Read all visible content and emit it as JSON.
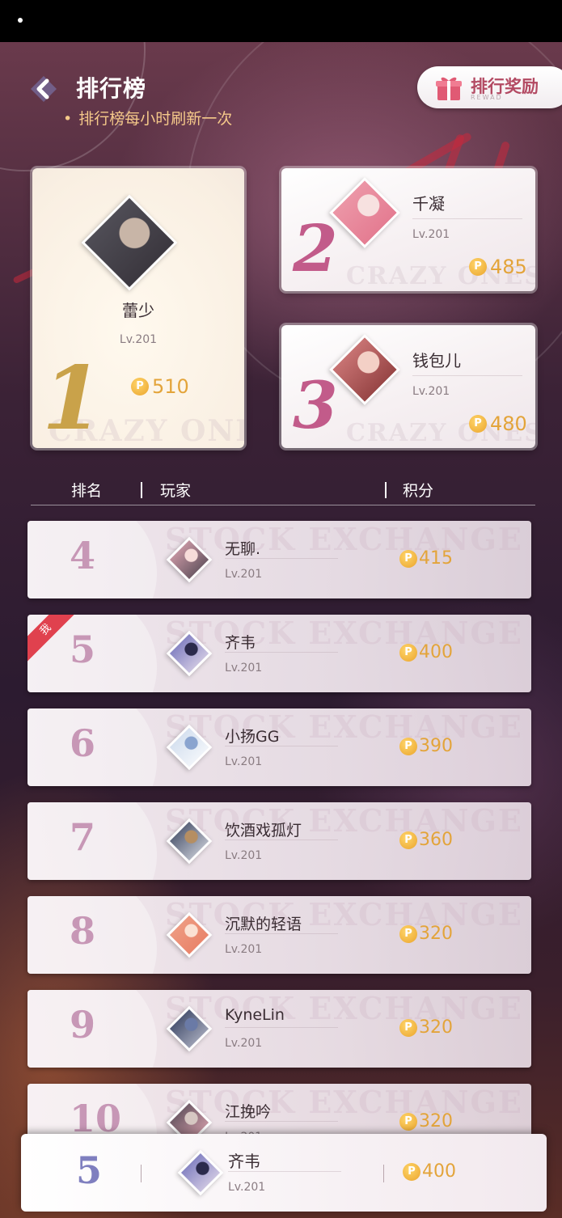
{
  "header": {
    "title": "排行榜",
    "subtitle": "排行榜每小时刷新一次",
    "reward_button": {
      "label": "排行奖励",
      "sub": "REWAD"
    }
  },
  "podium": [
    {
      "rank": "1",
      "name": "蕾少",
      "level": "Lv.201",
      "points": "510",
      "avatar_colors": [
        "#5b5a63",
        "#2f2a31",
        "#c8b5a7"
      ]
    },
    {
      "rank": "2",
      "name": "千凝",
      "level": "Lv.201",
      "points": "485",
      "avatar_colors": [
        "#f0a5b2",
        "#e06d86",
        "#f7e1e0"
      ]
    },
    {
      "rank": "3",
      "name": "钱包儿",
      "level": "Lv.201",
      "points": "480",
      "avatar_colors": [
        "#e58e8e",
        "#7a2a2a",
        "#f3d0c6"
      ]
    }
  ],
  "podium_ghost_text": "CRAZY ONES",
  "columns": {
    "rank": "排名",
    "player": "玩家",
    "score": "积分"
  },
  "rows": [
    {
      "rank": "4",
      "name": "无聊.",
      "level": "Lv.201",
      "points": "415",
      "me": false,
      "avatar_colors": [
        "#f3b3c0",
        "#3e3a45",
        "#f7dcd9"
      ]
    },
    {
      "rank": "5",
      "name": "齐韦",
      "level": "Lv.201",
      "points": "400",
      "me": true,
      "me_label": "我",
      "avatar_colors": [
        "#5d5fb2",
        "#f4e9f1",
        "#2b2a4c"
      ]
    },
    {
      "rank": "6",
      "name": "小扬GG",
      "level": "Lv.201",
      "points": "390",
      "me": false,
      "avatar_colors": [
        "#c7d6ea",
        "#ffffff",
        "#8aa4cf"
      ]
    },
    {
      "rank": "7",
      "name": "饮酒戏孤灯",
      "level": "Lv.201",
      "points": "360",
      "me": false,
      "avatar_colors": [
        "#27324f",
        "#e7e9ef",
        "#b58e62"
      ]
    },
    {
      "rank": "8",
      "name": "沉默的轻语",
      "level": "Lv.201",
      "points": "320",
      "me": false,
      "avatar_colors": [
        "#f0a58c",
        "#e7795f",
        "#fbe1d3"
      ]
    },
    {
      "rank": "9",
      "name": "KyneLin",
      "level": "Lv.201",
      "points": "320",
      "me": false,
      "avatar_colors": [
        "#1d2a4e",
        "#c9cbd8",
        "#6a7aa6"
      ]
    },
    {
      "rank": "10",
      "name": "江挽吟",
      "level": "Lv.201",
      "points": "320",
      "me": false,
      "avatar_colors": [
        "#3e3a45",
        "#f3b3c0",
        "#d6c7c2"
      ]
    }
  ],
  "row_ghost_text": "STOCK EXCHANGE",
  "my_rank": {
    "rank": "5",
    "name": "齐韦",
    "level": "Lv.201",
    "points": "400",
    "avatar_colors": [
      "#5d5fb2",
      "#f4e9f1",
      "#2b2a4c"
    ]
  },
  "coin_glyph": "P",
  "icons": {
    "back": "back-arrow-icon",
    "gift": "gift-icon",
    "coin": "coin-icon"
  }
}
